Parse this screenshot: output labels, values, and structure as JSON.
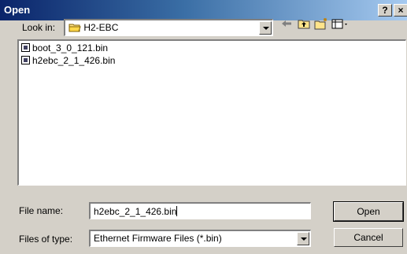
{
  "window": {
    "title": "Open",
    "help_label": "?",
    "close_label": "×"
  },
  "look_in": {
    "label": "Look in:",
    "value": "H2-EBC"
  },
  "toolbar": {
    "back_icon": "back-arrow-icon",
    "up_icon": "up-folder-icon",
    "new_folder_icon": "new-folder-icon",
    "view_menu_icon": "view-menu-icon"
  },
  "files": [
    {
      "name": "boot_3_0_121.bin"
    },
    {
      "name": "h2ebc_2_1_426.bin"
    }
  ],
  "file_name": {
    "label": "File name:",
    "value": "h2ebc_2_1_426.bin"
  },
  "file_type": {
    "label": "Files of type:",
    "value": "Ethernet Firmware Files (*.bin)"
  },
  "buttons": {
    "open": "Open",
    "cancel": "Cancel"
  }
}
